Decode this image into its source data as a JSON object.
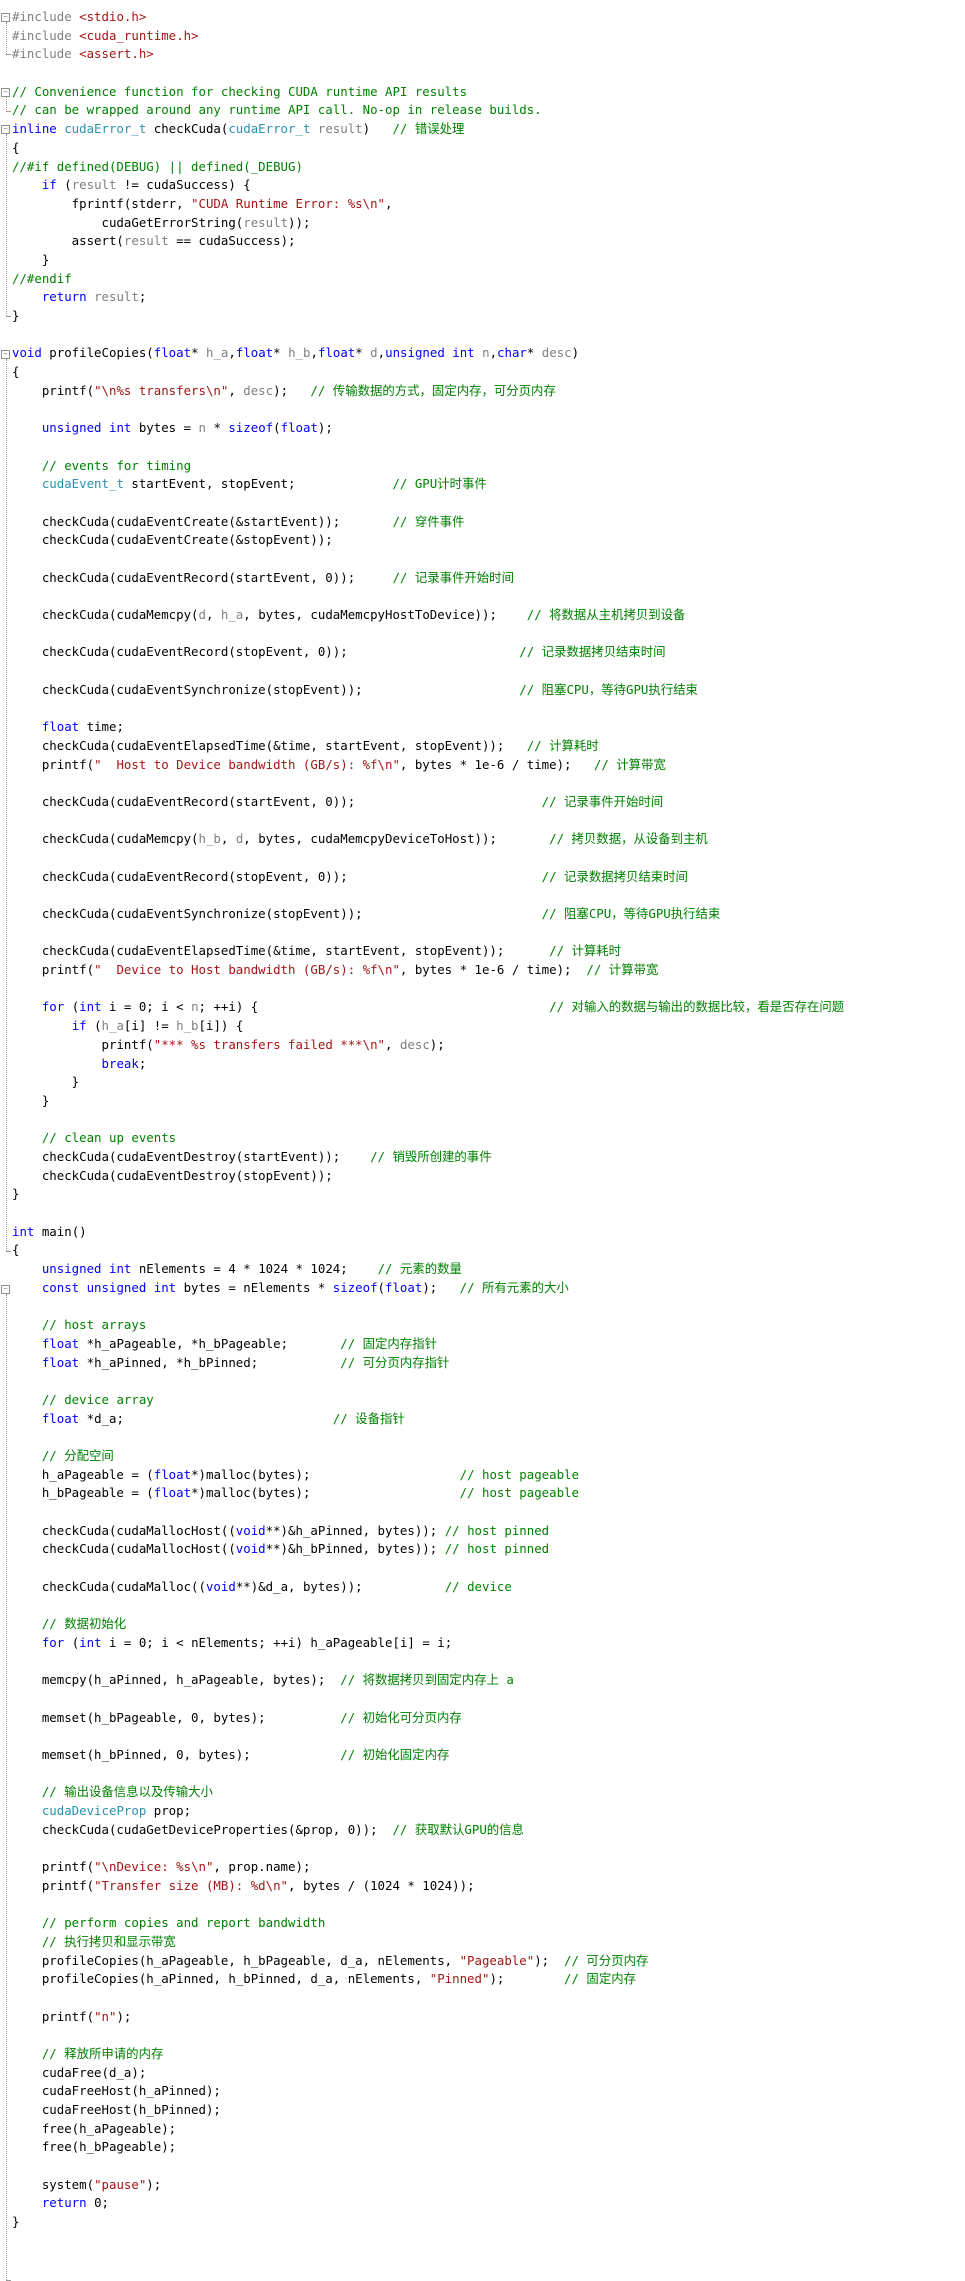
{
  "colors": {
    "background": "#ffffff",
    "keyword": "#0000ff",
    "type": "#2b91af",
    "preprocessor": "#808080",
    "string": "#a31515",
    "comment": "#008000",
    "plain": "#000000",
    "parameter": "#808080"
  },
  "icons": {
    "fold_expanded": "minus-square-icon"
  },
  "code_lines": [
    [
      [
        "pp",
        "#include "
      ],
      [
        "str",
        "<stdio.h>"
      ]
    ],
    [
      [
        "pp",
        "#include "
      ],
      [
        "str",
        "<cuda_runtime.h>"
      ]
    ],
    [
      [
        "pp",
        "#include "
      ],
      [
        "str",
        "<assert.h>"
      ]
    ],
    [],
    [
      [
        "cm",
        "// Convenience function for checking CUDA runtime API results"
      ]
    ],
    [
      [
        "cm",
        "// can be wrapped around any runtime API call. No-op in release builds."
      ]
    ],
    [
      [
        "kw",
        "inline "
      ],
      [
        "ty",
        "cudaError_t"
      ],
      [
        "pl",
        " checkCuda("
      ],
      [
        "ty",
        "cudaError_t"
      ],
      [
        "pm",
        " result"
      ],
      [
        "pl",
        ")   "
      ],
      [
        "cm",
        "// 错误处理"
      ]
    ],
    [
      [
        "pl",
        "{"
      ]
    ],
    [
      [
        "cm",
        "//#if defined(DEBUG) || defined(_DEBUG)"
      ]
    ],
    [
      [
        "pl",
        "    "
      ],
      [
        "kw",
        "if"
      ],
      [
        "pl",
        " ("
      ],
      [
        "pm",
        "result"
      ],
      [
        "pl",
        " != cudaSuccess) {"
      ]
    ],
    [
      [
        "pl",
        "        fprintf(stderr, "
      ],
      [
        "str",
        "\"CUDA Runtime Error: %s\\n\""
      ],
      [
        "pl",
        ","
      ]
    ],
    [
      [
        "pl",
        "            cudaGetErrorString("
      ],
      [
        "pm",
        "result"
      ],
      [
        "pl",
        "));"
      ]
    ],
    [
      [
        "pl",
        "        assert("
      ],
      [
        "pm",
        "result"
      ],
      [
        "pl",
        " == cudaSuccess);"
      ]
    ],
    [
      [
        "pl",
        "    }"
      ]
    ],
    [
      [
        "cm",
        "//#endif"
      ]
    ],
    [
      [
        "pl",
        "    "
      ],
      [
        "kw",
        "return"
      ],
      [
        "pm",
        " result"
      ],
      [
        "pl",
        ";"
      ]
    ],
    [
      [
        "pl",
        "}"
      ]
    ],
    [],
    [
      [
        "kw",
        "void"
      ],
      [
        "pl",
        " profileCopies("
      ],
      [
        "kw",
        "float"
      ],
      [
        "pl",
        "* "
      ],
      [
        "pm",
        "h_a"
      ],
      [
        "pl",
        ","
      ],
      [
        "kw",
        "float"
      ],
      [
        "pl",
        "* "
      ],
      [
        "pm",
        "h_b"
      ],
      [
        "pl",
        ","
      ],
      [
        "kw",
        "float"
      ],
      [
        "pl",
        "* "
      ],
      [
        "pm",
        "d"
      ],
      [
        "pl",
        ","
      ],
      [
        "kw",
        "unsigned int"
      ],
      [
        "pm",
        " n"
      ],
      [
        "pl",
        ","
      ],
      [
        "kw",
        "char"
      ],
      [
        "pl",
        "* "
      ],
      [
        "pm",
        "desc"
      ],
      [
        "pl",
        ")"
      ]
    ],
    [
      [
        "pl",
        "{"
      ]
    ],
    [
      [
        "pl",
        "    printf("
      ],
      [
        "str",
        "\"\\n%s transfers\\n\""
      ],
      [
        "pl",
        ", "
      ],
      [
        "pm",
        "desc"
      ],
      [
        "pl",
        ");   "
      ],
      [
        "cm",
        "// 传输数据的方式，固定内存，可分页内存"
      ]
    ],
    [],
    [
      [
        "pl",
        "    "
      ],
      [
        "kw",
        "unsigned int"
      ],
      [
        "pl",
        " bytes = "
      ],
      [
        "pm",
        "n"
      ],
      [
        "pl",
        " * "
      ],
      [
        "kw",
        "sizeof"
      ],
      [
        "pl",
        "("
      ],
      [
        "kw",
        "float"
      ],
      [
        "pl",
        ");"
      ]
    ],
    [],
    [
      [
        "pl",
        "    "
      ],
      [
        "cm",
        "// events for timing"
      ]
    ],
    [
      [
        "pl",
        "    "
      ],
      [
        "ty",
        "cudaEvent_t"
      ],
      [
        "pl",
        " startEvent, stopEvent;             "
      ],
      [
        "cm",
        "// GPU计时事件"
      ]
    ],
    [],
    [
      [
        "pl",
        "    checkCuda(cudaEventCreate(&startEvent));       "
      ],
      [
        "cm",
        "// 穿件事件"
      ]
    ],
    [
      [
        "pl",
        "    checkCuda(cudaEventCreate(&stopEvent));"
      ]
    ],
    [],
    [
      [
        "pl",
        "    checkCuda(cudaEventRecord(startEvent, 0));     "
      ],
      [
        "cm",
        "// 记录事件开始时间"
      ]
    ],
    [],
    [
      [
        "pl",
        "    checkCuda(cudaMemcpy("
      ],
      [
        "pm",
        "d"
      ],
      [
        "pl",
        ", "
      ],
      [
        "pm",
        "h_a"
      ],
      [
        "pl",
        ", bytes, cudaMemcpyHostToDevice));    "
      ],
      [
        "cm",
        "// 将数据从主机拷贝到设备"
      ]
    ],
    [],
    [
      [
        "pl",
        "    checkCuda(cudaEventRecord(stopEvent, 0));                       "
      ],
      [
        "cm",
        "// 记录数据拷贝结束时间"
      ]
    ],
    [],
    [
      [
        "pl",
        "    checkCuda(cudaEventSynchronize(stopEvent));                     "
      ],
      [
        "cm",
        "// 阻塞CPU，等待GPU执行结束"
      ]
    ],
    [],
    [
      [
        "pl",
        "    "
      ],
      [
        "kw",
        "float"
      ],
      [
        "pl",
        " time;"
      ]
    ],
    [
      [
        "pl",
        "    checkCuda(cudaEventElapsedTime(&time, startEvent, stopEvent));   "
      ],
      [
        "cm",
        "// 计算耗时"
      ]
    ],
    [
      [
        "pl",
        "    printf("
      ],
      [
        "str",
        "\"  Host to Device bandwidth (GB/s): %f\\n\""
      ],
      [
        "pl",
        ", bytes * 1e-6 / time);   "
      ],
      [
        "cm",
        "// 计算带宽"
      ]
    ],
    [],
    [
      [
        "pl",
        "    checkCuda(cudaEventRecord(startEvent, 0));                         "
      ],
      [
        "cm",
        "// 记录事件开始时间"
      ]
    ],
    [],
    [
      [
        "pl",
        "    checkCuda(cudaMemcpy("
      ],
      [
        "pm",
        "h_b"
      ],
      [
        "pl",
        ", "
      ],
      [
        "pm",
        "d"
      ],
      [
        "pl",
        ", bytes, cudaMemcpyDeviceToHost));       "
      ],
      [
        "cm",
        "// 拷贝数据，从设备到主机"
      ]
    ],
    [],
    [
      [
        "pl",
        "    checkCuda(cudaEventRecord(stopEvent, 0));                          "
      ],
      [
        "cm",
        "// 记录数据拷贝结束时间"
      ]
    ],
    [],
    [
      [
        "pl",
        "    checkCuda(cudaEventSynchronize(stopEvent));                        "
      ],
      [
        "cm",
        "// 阻塞CPU，等待GPU执行结束"
      ]
    ],
    [],
    [
      [
        "pl",
        "    checkCuda(cudaEventElapsedTime(&time, startEvent, stopEvent));      "
      ],
      [
        "cm",
        "// 计算耗时"
      ]
    ],
    [
      [
        "pl",
        "    printf("
      ],
      [
        "str",
        "\"  Device to Host bandwidth (GB/s): %f\\n\""
      ],
      [
        "pl",
        ", bytes * 1e-6 / time);  "
      ],
      [
        "cm",
        "// 计算带宽"
      ]
    ],
    [],
    [
      [
        "pl",
        "    "
      ],
      [
        "kw",
        "for"
      ],
      [
        "pl",
        " ("
      ],
      [
        "kw",
        "int"
      ],
      [
        "pl",
        " i = 0; i < "
      ],
      [
        "pm",
        "n"
      ],
      [
        "pl",
        "; ++i) {                                       "
      ],
      [
        "cm",
        "// 对输入的数据与输出的数据比较，看是否存在问题"
      ]
    ],
    [
      [
        "pl",
        "        "
      ],
      [
        "kw",
        "if"
      ],
      [
        "pl",
        " ("
      ],
      [
        "pm",
        "h_a"
      ],
      [
        "pl",
        "[i] != "
      ],
      [
        "pm",
        "h_b"
      ],
      [
        "pl",
        "[i]) {"
      ]
    ],
    [
      [
        "pl",
        "            printf("
      ],
      [
        "str",
        "\"*** %s transfers failed ***\\n\""
      ],
      [
        "pl",
        ", "
      ],
      [
        "pm",
        "desc"
      ],
      [
        "pl",
        ");"
      ]
    ],
    [
      [
        "pl",
        "            "
      ],
      [
        "kw",
        "break"
      ],
      [
        "pl",
        ";"
      ]
    ],
    [
      [
        "pl",
        "        }"
      ]
    ],
    [
      [
        "pl",
        "    }"
      ]
    ],
    [],
    [
      [
        "pl",
        "    "
      ],
      [
        "cm",
        "// clean up events"
      ]
    ],
    [
      [
        "pl",
        "    checkCuda(cudaEventDestroy(startEvent));    "
      ],
      [
        "cm",
        "// 销毁所创建的事件"
      ]
    ],
    [
      [
        "pl",
        "    checkCuda(cudaEventDestroy(stopEvent));"
      ]
    ],
    [
      [
        "pl",
        "}"
      ]
    ],
    [],
    [
      [
        "kw",
        "int"
      ],
      [
        "pl",
        " main()"
      ]
    ],
    [
      [
        "pl",
        "{"
      ]
    ],
    [
      [
        "pl",
        "    "
      ],
      [
        "kw",
        "unsigned int"
      ],
      [
        "pl",
        " nElements = 4 * 1024 * 1024;    "
      ],
      [
        "cm",
        "// 元素的数量"
      ]
    ],
    [
      [
        "pl",
        "    "
      ],
      [
        "kw",
        "const unsigned int"
      ],
      [
        "pl",
        " bytes = nElements * "
      ],
      [
        "kw",
        "sizeof"
      ],
      [
        "pl",
        "("
      ],
      [
        "kw",
        "float"
      ],
      [
        "pl",
        ");   "
      ],
      [
        "cm",
        "// 所有元素的大小"
      ]
    ],
    [],
    [
      [
        "pl",
        "    "
      ],
      [
        "cm",
        "// host arrays"
      ]
    ],
    [
      [
        "pl",
        "    "
      ],
      [
        "kw",
        "float"
      ],
      [
        "pl",
        " *h_aPageable, *h_bPageable;       "
      ],
      [
        "cm",
        "// 固定内存指针"
      ]
    ],
    [
      [
        "pl",
        "    "
      ],
      [
        "kw",
        "float"
      ],
      [
        "pl",
        " *h_aPinned, *h_bPinned;           "
      ],
      [
        "cm",
        "// 可分页内存指针"
      ]
    ],
    [],
    [
      [
        "pl",
        "    "
      ],
      [
        "cm",
        "// device array"
      ]
    ],
    [
      [
        "pl",
        "    "
      ],
      [
        "kw",
        "float"
      ],
      [
        "pl",
        " *d_a;                            "
      ],
      [
        "cm",
        "// 设备指针"
      ]
    ],
    [],
    [
      [
        "pl",
        "    "
      ],
      [
        "cm",
        "// 分配空间"
      ]
    ],
    [
      [
        "pl",
        "    h_aPageable = ("
      ],
      [
        "kw",
        "float"
      ],
      [
        "pl",
        "*)malloc(bytes);                    "
      ],
      [
        "cm",
        "// host pageable"
      ]
    ],
    [
      [
        "pl",
        "    h_bPageable = ("
      ],
      [
        "kw",
        "float"
      ],
      [
        "pl",
        "*)malloc(bytes);                    "
      ],
      [
        "cm",
        "// host pageable"
      ]
    ],
    [],
    [
      [
        "pl",
        "    checkCuda(cudaMallocHost(("
      ],
      [
        "kw",
        "void"
      ],
      [
        "pl",
        "**)&h_aPinned, bytes)); "
      ],
      [
        "cm",
        "// host pinned"
      ]
    ],
    [
      [
        "pl",
        "    checkCuda(cudaMallocHost(("
      ],
      [
        "kw",
        "void"
      ],
      [
        "pl",
        "**)&h_bPinned, bytes)); "
      ],
      [
        "cm",
        "// host pinned"
      ]
    ],
    [],
    [
      [
        "pl",
        "    checkCuda(cudaMalloc(("
      ],
      [
        "kw",
        "void"
      ],
      [
        "pl",
        "**)&d_a, bytes));           "
      ],
      [
        "cm",
        "// device"
      ]
    ],
    [],
    [
      [
        "pl",
        "    "
      ],
      [
        "cm",
        "// 数据初始化"
      ]
    ],
    [
      [
        "pl",
        "    "
      ],
      [
        "kw",
        "for"
      ],
      [
        "pl",
        " ("
      ],
      [
        "kw",
        "int"
      ],
      [
        "pl",
        " i = 0; i < nElements; ++i) h_aPageable[i] = i;"
      ]
    ],
    [],
    [
      [
        "pl",
        "    memcpy(h_aPinned, h_aPageable, bytes);  "
      ],
      [
        "cm",
        "// 将数据拷贝到固定内存上 a"
      ]
    ],
    [],
    [
      [
        "pl",
        "    memset(h_bPageable, 0, bytes);          "
      ],
      [
        "cm",
        "// 初始化可分页内存"
      ]
    ],
    [],
    [
      [
        "pl",
        "    memset(h_bPinned, 0, bytes);            "
      ],
      [
        "cm",
        "// 初始化固定内存"
      ]
    ],
    [],
    [
      [
        "pl",
        "    "
      ],
      [
        "cm",
        "// 输出设备信息以及传输大小"
      ]
    ],
    [
      [
        "pl",
        "    "
      ],
      [
        "ty",
        "cudaDeviceProp"
      ],
      [
        "pl",
        " prop;"
      ]
    ],
    [
      [
        "pl",
        "    checkCuda(cudaGetDeviceProperties(&prop, 0));  "
      ],
      [
        "cm",
        "// 获取默认GPU的信息"
      ]
    ],
    [],
    [
      [
        "pl",
        "    printf("
      ],
      [
        "str",
        "\"\\nDevice: %s\\n\""
      ],
      [
        "pl",
        ", prop.name);"
      ]
    ],
    [
      [
        "pl",
        "    printf("
      ],
      [
        "str",
        "\"Transfer size (MB): %d\\n\""
      ],
      [
        "pl",
        ", bytes / (1024 * 1024));"
      ]
    ],
    [],
    [
      [
        "pl",
        "    "
      ],
      [
        "cm",
        "// perform copies and report bandwidth"
      ]
    ],
    [
      [
        "pl",
        "    "
      ],
      [
        "cm",
        "// 执行拷贝和显示带宽"
      ]
    ],
    [
      [
        "pl",
        "    profileCopies(h_aPageable, h_bPageable, d_a, nElements, "
      ],
      [
        "str",
        "\"Pageable\""
      ],
      [
        "pl",
        ");  "
      ],
      [
        "cm",
        "// 可分页内存"
      ]
    ],
    [
      [
        "pl",
        "    profileCopies(h_aPinned, h_bPinned, d_a, nElements, "
      ],
      [
        "str",
        "\"Pinned\""
      ],
      [
        "pl",
        ");        "
      ],
      [
        "cm",
        "// 固定内存"
      ]
    ],
    [],
    [
      [
        "pl",
        "    printf("
      ],
      [
        "str",
        "\"n\""
      ],
      [
        "pl",
        ");"
      ]
    ],
    [],
    [
      [
        "pl",
        "    "
      ],
      [
        "cm",
        "// 释放所申请的内存"
      ]
    ],
    [
      [
        "pl",
        "    cudaFree(d_a);"
      ]
    ],
    [
      [
        "pl",
        "    cudaFreeHost(h_aPinned);"
      ]
    ],
    [
      [
        "pl",
        "    cudaFreeHost(h_bPinned);"
      ]
    ],
    [
      [
        "pl",
        "    free(h_aPageable);"
      ]
    ],
    [
      [
        "pl",
        "    free(h_bPageable);"
      ]
    ],
    [],
    [
      [
        "pl",
        "    system("
      ],
      [
        "str",
        "\"pause\""
      ],
      [
        "pl",
        ");"
      ]
    ],
    [
      [
        "pl",
        "    "
      ],
      [
        "kw",
        "return"
      ],
      [
        "pl",
        " 0;"
      ]
    ],
    [
      [
        "pl",
        "}"
      ]
    ]
  ]
}
